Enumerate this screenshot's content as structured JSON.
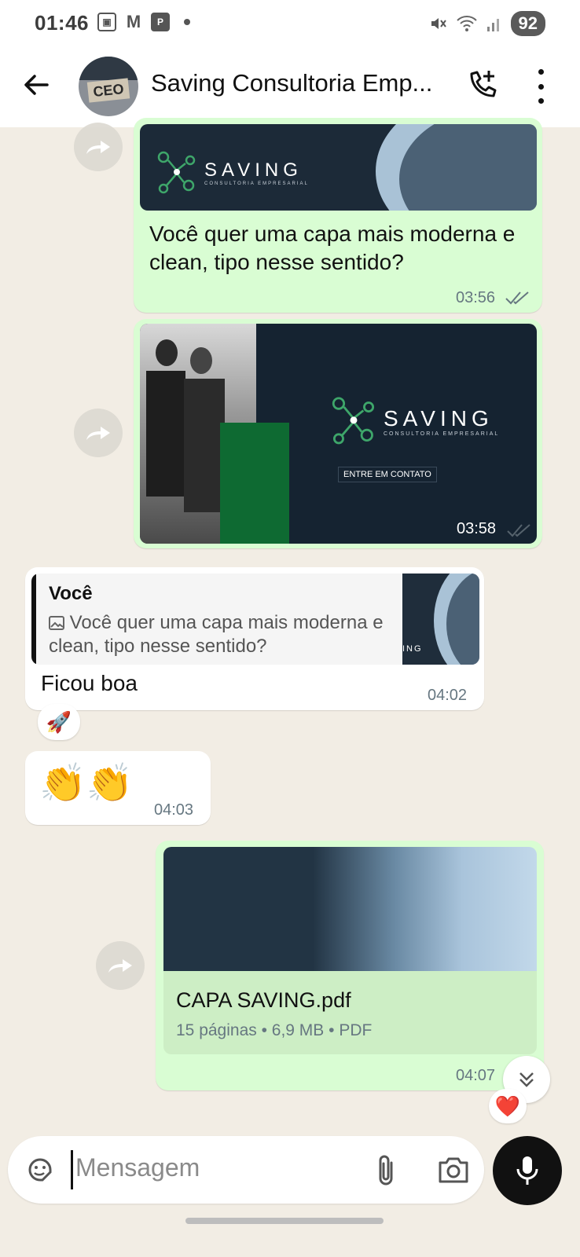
{
  "status_bar": {
    "time": "01:46",
    "left_icons": [
      "screenshot-icon",
      "gmail-icon",
      "p-icon"
    ],
    "right_icons": [
      "mute-icon",
      "wifi-icon",
      "signal-icon"
    ],
    "battery": "92"
  },
  "header": {
    "contact_name": "Saving Consultoria Emp...",
    "avatar_text": "CEO",
    "avatar_brand": "SAVING"
  },
  "messages": [
    {
      "id": "m1",
      "direction": "out",
      "image": {
        "brand": "SAVING",
        "tagline": "CONSULTORIA EMPRESARIAL"
      },
      "text": "Você quer uma capa mais moderna e clean, tipo nesse sentido?",
      "time": "03:56"
    },
    {
      "id": "m2",
      "direction": "out",
      "image": {
        "brand": "SAVING",
        "tagline": "CONSULTORIA EMPRESARIAL",
        "cta": "ENTRE EM CONTATO"
      },
      "time": "03:58"
    },
    {
      "id": "m3",
      "direction": "in",
      "quote": {
        "author": "Você",
        "text": "Você quer uma capa mais moderna e clean, tipo nesse sentido?",
        "thumb_label": "ING"
      },
      "text": "Ficou boa",
      "time": "04:02",
      "reaction": "🚀"
    },
    {
      "id": "m4",
      "direction": "in",
      "text": "👏👏",
      "time": "04:03"
    },
    {
      "id": "m5",
      "direction": "out",
      "document": {
        "name": "CAPA SAVING.pdf",
        "meta": "15 páginas • 6,9 MB • PDF"
      },
      "time": "04:07",
      "reaction": "❤️"
    }
  ],
  "composer": {
    "placeholder": "Mensagem"
  },
  "colors": {
    "outgoing_bubble": "#d9fdd3",
    "incoming_bubble": "#ffffff",
    "brand_green": "#2e9e5a",
    "chat_background": "#f2ede4"
  }
}
